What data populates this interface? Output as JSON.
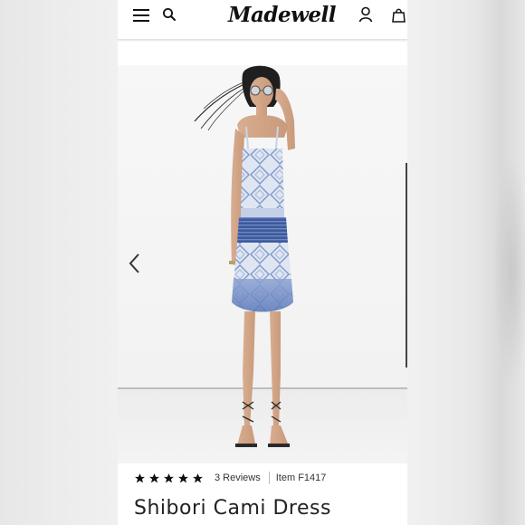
{
  "header": {
    "logo_text": "Madewell",
    "menu_icon": "hamburger-menu-icon",
    "search_icon": "search-icon",
    "account_icon": "account-icon",
    "bag_icon": "shopping-bag-icon"
  },
  "gallery": {
    "image_subject": "model wearing shibori cami dress",
    "prev_icon": "chevron-left-icon"
  },
  "product": {
    "rating_stars": 5,
    "reviews_label": "3 Reviews",
    "item_label": "Item F1417",
    "title": "Shibori Cami Dress"
  },
  "colors": {
    "text": "#222222",
    "dress_blue": "#5b78b8",
    "dress_light": "#dfe6f2"
  }
}
